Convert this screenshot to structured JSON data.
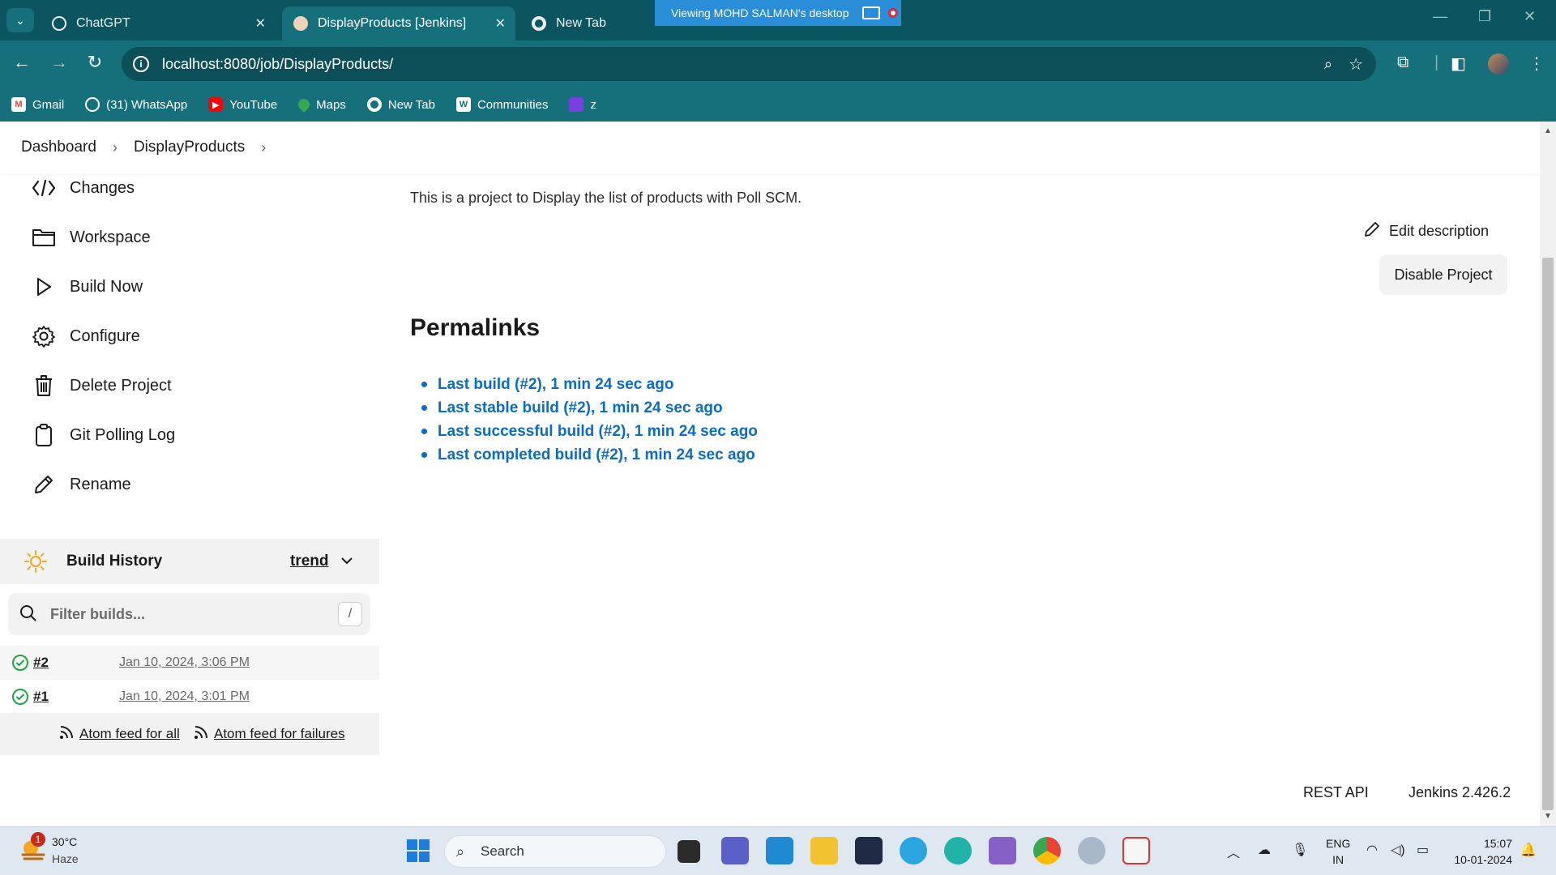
{
  "browser": {
    "tabs": [
      {
        "title": "ChatGPT",
        "active": false
      },
      {
        "title": "DisplayProducts [Jenkins]",
        "active": true
      },
      {
        "title": "New Tab",
        "active": false
      }
    ],
    "remote_banner": "Viewing MOHD  SALMAN's desktop",
    "url": "localhost:8080/job/DisplayProducts/",
    "bookmarks": [
      "Gmail",
      "(31) WhatsApp",
      "YouTube",
      "Maps",
      "New Tab",
      "Communities",
      "z"
    ]
  },
  "breadcrumb": {
    "items": [
      "Dashboard",
      "DisplayProducts"
    ]
  },
  "sidebar": {
    "items": [
      {
        "label": "Changes",
        "icon": "code-icon"
      },
      {
        "label": "Workspace",
        "icon": "folder-icon"
      },
      {
        "label": "Build Now",
        "icon": "play-icon"
      },
      {
        "label": "Configure",
        "icon": "gear-icon"
      },
      {
        "label": "Delete Project",
        "icon": "trash-icon"
      },
      {
        "label": "Git Polling Log",
        "icon": "clipboard-icon"
      },
      {
        "label": "Rename",
        "icon": "pencil-icon"
      }
    ]
  },
  "build_history": {
    "title": "Build History",
    "trend": "trend",
    "filter_placeholder": "Filter builds...",
    "filter_shortcut": "/",
    "builds": [
      {
        "number": "#2",
        "date": "Jan 10, 2024, 3:06 PM",
        "status": "success"
      },
      {
        "number": "#1",
        "date": "Jan 10, 2024, 3:01 PM",
        "status": "success"
      }
    ],
    "feed_all": "Atom feed for all",
    "feed_failures": "Atom feed for failures"
  },
  "main": {
    "description": "This is a project to Display the list of products with Poll SCM.",
    "edit_description": "Edit description",
    "disable_project": "Disable Project",
    "permalinks_title": "Permalinks",
    "permalinks": [
      "Last build (#2), 1 min 24 sec ago",
      "Last stable build (#2), 1 min 24 sec ago",
      "Last successful build (#2), 1 min 24 sec ago",
      "Last completed build (#2), 1 min 24 sec ago"
    ]
  },
  "footer": {
    "rest_api": "REST API",
    "version": "Jenkins 2.426.2"
  },
  "taskbar": {
    "weather_temp": "30°C",
    "weather_cond": "Haze",
    "weather_badge": "1",
    "search_label": "Search",
    "lang_top": "ENG",
    "lang_bottom": "IN",
    "time": "15:07",
    "date": "10-01-2024"
  },
  "colors": {
    "accent": "#16707c",
    "link": "#0b6bcb",
    "success": "#1ea446"
  }
}
